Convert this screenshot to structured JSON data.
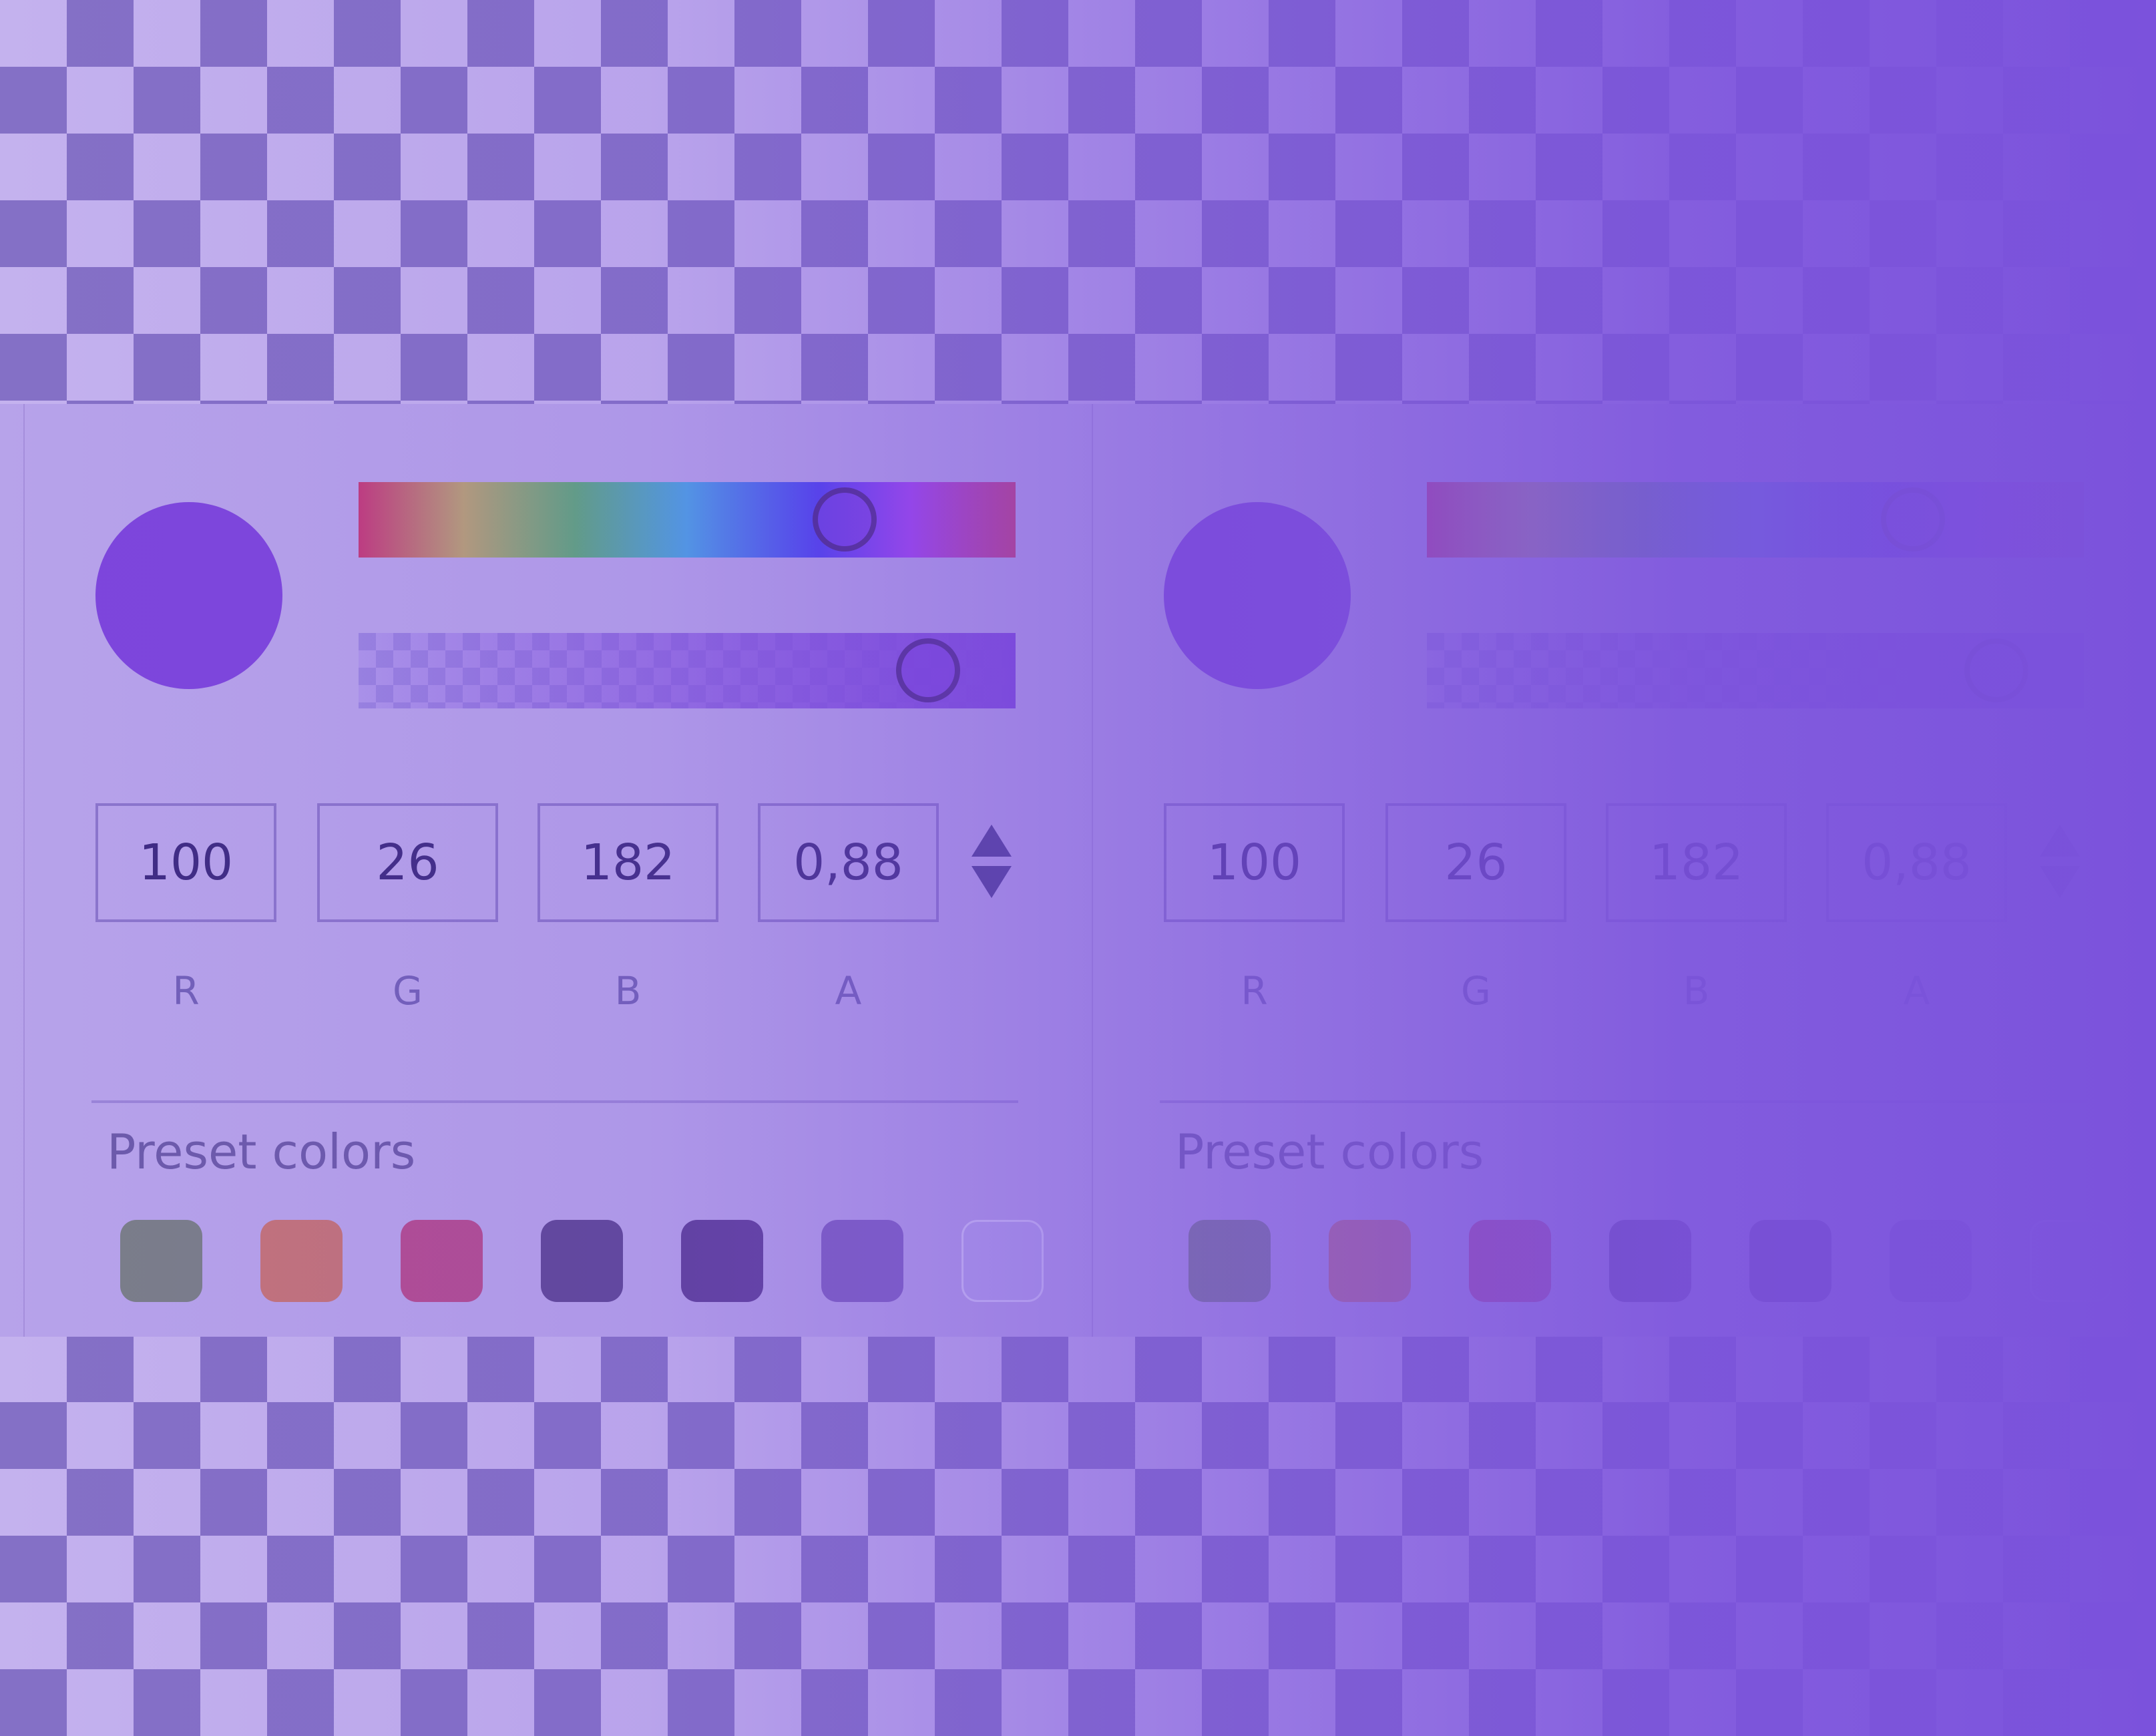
{
  "colors": {
    "selected": "#7D45DC",
    "accent": "#7B52DC"
  },
  "pickers": [
    {
      "id": "picker-1",
      "rgba": {
        "r": "100",
        "g": "26",
        "b": "182",
        "a": "0,88"
      },
      "labels": {
        "r": "R",
        "g": "G",
        "b": "B",
        "a": "A"
      },
      "preset_title": "Preset colors",
      "presets": [
        "#7A7E88",
        "#C47378",
        "#B34C90",
        "#5E4696",
        "#5D3E98",
        "#7D5EC0",
        "#B8A7EE"
      ]
    },
    {
      "id": "picker-2",
      "rgba": {
        "r": "100",
        "g": "26",
        "b": "182",
        "a": "0,88"
      },
      "labels": {
        "r": "R",
        "g": "G",
        "b": "B",
        "a": "A"
      },
      "preset_title": "Preset colors",
      "presets": [
        "#7A7E88",
        "#C47378",
        "#B34C90",
        "#5E4696",
        "#5D3E98",
        "#7D5EC0",
        "#B8A7EE"
      ]
    }
  ],
  "hue_value": 0.74,
  "alpha_value": 0.88
}
